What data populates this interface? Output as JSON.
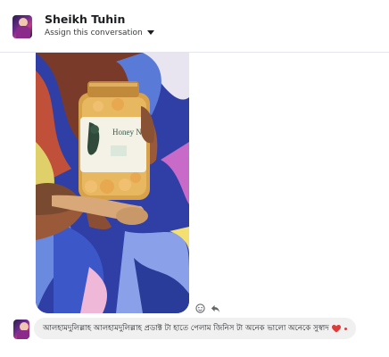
{
  "header": {
    "contact_name": "Sheikh Tuhin",
    "assign_label": "Assign this conversation"
  },
  "photo": {
    "label_text": "Honey Nut"
  },
  "message": {
    "text": "আলহামদুলিল্লাহ আলহামদুলিল্লাহ প্রডাক্ট টা হাতে পেলাম জিনিস টা অনেক ভালো অনেকে সুস্বাদ",
    "reaction_color": "#e03a3a"
  },
  "icons": {
    "react": "smiley-icon",
    "reply": "reply-icon",
    "caret": "caret-down-icon"
  }
}
